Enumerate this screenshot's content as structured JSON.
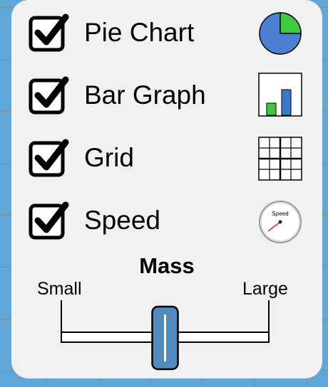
{
  "options": [
    {
      "label": "Pie Chart",
      "checked": true,
      "icon": "pie-chart-icon"
    },
    {
      "label": "Bar Graph",
      "checked": true,
      "icon": "bar-graph-icon"
    },
    {
      "label": "Grid",
      "checked": true,
      "icon": "grid-icon"
    },
    {
      "label": "Speed",
      "checked": true,
      "icon": "speedometer-icon"
    }
  ],
  "speed_icon_text": "Speed",
  "mass": {
    "title": "Mass",
    "min_label": "Small",
    "max_label": "Large",
    "value_fraction": 0.5
  },
  "colors": {
    "background": "#5fa6d9",
    "panel": "#f1f1f1",
    "pie_blue": "#4a7fd3",
    "pie_green": "#3fc93f",
    "bar_green": "#3fc93f",
    "bar_blue": "#3a78d0",
    "thumb": "#4f8cbb",
    "needle": "#e02020"
  }
}
